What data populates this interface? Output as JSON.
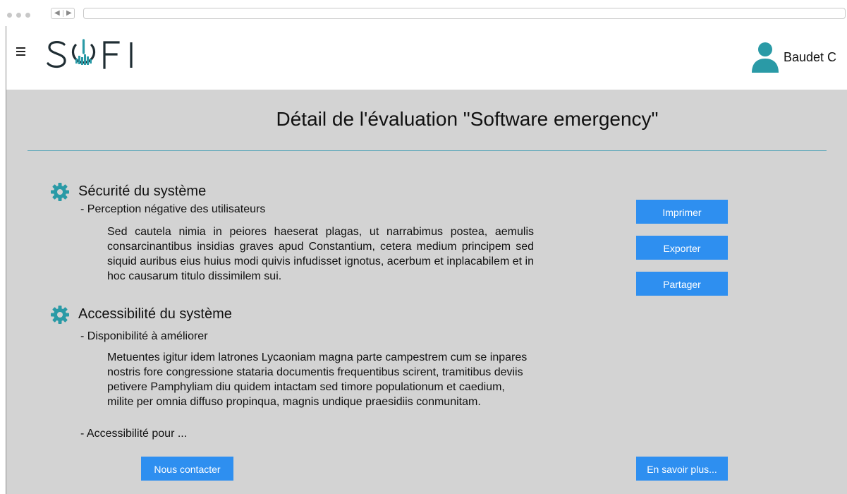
{
  "app": {
    "logo_text": "SOFI",
    "user_name": "Baudet C"
  },
  "colors": {
    "accent_teal": "#2a9aa6",
    "button_blue": "#2e8ff0",
    "content_bg": "#d3d3d3",
    "divider": "#5aa6b8"
  },
  "icons": {
    "menu": "hamburger-icon",
    "user": "user-avatar-icon",
    "section": "gear-icon"
  },
  "page": {
    "title": "Détail de l'évaluation \"Software emergency\""
  },
  "sections": [
    {
      "title": "Sécurité du système",
      "issues": [
        {
          "label": "- Perception négative des utilisateurs",
          "text": "Sed cautela nimia in peiores haeserat plagas, ut narrabimus postea, aemulis consarcinantibus insidias graves apud Constantium, cetera medium principem sed siquid auribus eius huius modi quivis infudisset ignotus, acerbum et inplacabilem et in hoc causarum titulo dissimilem sui."
        }
      ]
    },
    {
      "title": "Accessibilité du système",
      "issues": [
        {
          "label": "- Disponibilité à améliorer",
          "text": "Metuentes igitur idem latrones Lycaoniam magna parte campestrem cum se inpares nostris fore congressione stataria documentis frequentibus scirent, tramitibus deviis petivere Pamphyliam diu quidem intactam sed timore populationum et caedium, milite per omnia diffuso propinqua, magnis undique praesidiis conmunitam."
        },
        {
          "label": "- Accessibilité pour ..."
        }
      ]
    }
  ],
  "actions": {
    "print": "Imprimer",
    "export": "Exporter",
    "share": "Partager",
    "contact": "Nous contacter",
    "learn_more": "En savoir plus..."
  }
}
